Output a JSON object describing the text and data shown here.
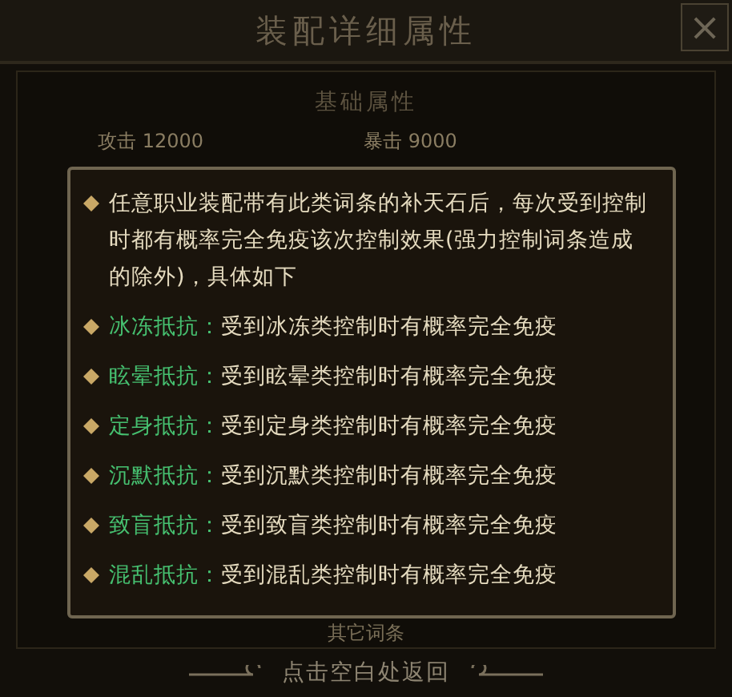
{
  "window": {
    "title": "装配详细属性",
    "close": "×"
  },
  "section": {
    "title": "基础属性"
  },
  "stats": [
    {
      "label": "攻击",
      "value": "12000"
    },
    {
      "label": "暴击",
      "value": "9000"
    }
  ],
  "section_2": {
    "title": "其它词条"
  },
  "tooltip": {
    "items": [
      {
        "kind": "note",
        "text": "任意职业装配带有此类词条的补天石后，每次受到控制时都有概率完全免疫该次控制效果(强力控制词条造成的除外)，具体如下"
      },
      {
        "kind": "entry",
        "name": "冰冻抵抗：",
        "text": "受到冰冻类控制时有概率完全免疫"
      },
      {
        "kind": "entry",
        "name": "眩晕抵抗：",
        "text": "受到眩晕类控制时有概率完全免疫"
      },
      {
        "kind": "entry",
        "name": "定身抵抗：",
        "text": "受到定身类控制时有概率完全免疫"
      },
      {
        "kind": "entry",
        "name": "沉默抵抗：",
        "text": "受到沉默类控制时有概率完全免疫"
      },
      {
        "kind": "entry",
        "name": "致盲抵抗：",
        "text": "受到致盲类控制时有概率完全免疫"
      },
      {
        "kind": "entry",
        "name": "混乱抵抗：",
        "text": "受到混乱类控制时有概率完全免疫"
      }
    ]
  },
  "footer": {
    "hint": "点击空白处返回"
  }
}
